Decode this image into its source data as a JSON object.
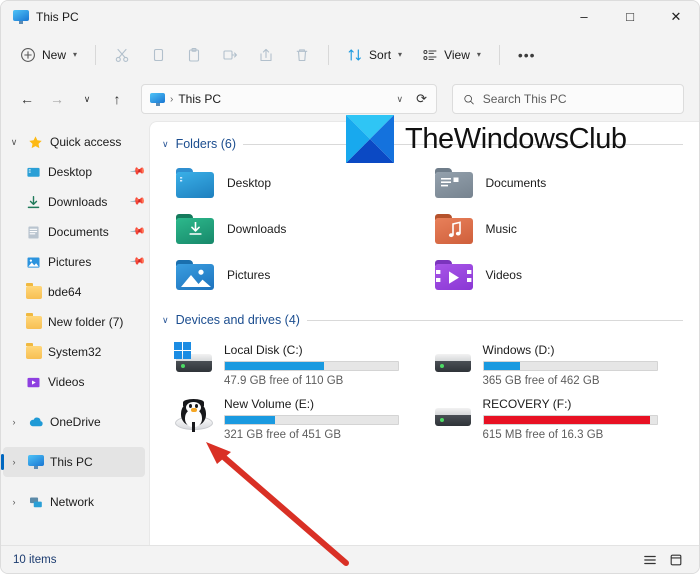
{
  "window": {
    "title": "This PC",
    "title_icon": "monitor-icon",
    "controls": {
      "minimize": "–",
      "maximize": "□",
      "close": "✕"
    }
  },
  "toolbar": {
    "new_label": "New",
    "sort_label": "Sort",
    "view_label": "View",
    "more_label": "•••",
    "icons": [
      "plus-icon",
      "cut-icon",
      "copy-icon",
      "paste-icon",
      "rename-icon",
      "share-icon",
      "delete-icon",
      "sort-icon",
      "view-icon",
      "more-icon"
    ]
  },
  "nav": {
    "back": "←",
    "forward": "→",
    "recent": "∨",
    "up": "↑",
    "refresh": "⟳",
    "address_text": "This PC",
    "address_icon": "monitor-icon",
    "crumb_sep": "›",
    "address_chevron": "∨"
  },
  "search": {
    "placeholder": "Search This PC",
    "value": "",
    "icon": "search-icon"
  },
  "sidebar": {
    "groups": [
      {
        "label": "Quick access",
        "icon": "star-icon",
        "expander": "∨",
        "expanded": true,
        "selected": false,
        "children": [
          {
            "label": "Desktop",
            "icon": "desktop-icon",
            "pinned": true
          },
          {
            "label": "Downloads",
            "icon": "downloads-icon",
            "pinned": true
          },
          {
            "label": "Documents",
            "icon": "documents-icon",
            "pinned": true
          },
          {
            "label": "Pictures",
            "icon": "pictures-icon",
            "pinned": true
          },
          {
            "label": "bde64",
            "icon": "folder-icon",
            "pinned": false
          },
          {
            "label": "New folder (7)",
            "icon": "folder-icon",
            "pinned": false
          },
          {
            "label": "System32",
            "icon": "folder-icon",
            "pinned": false
          },
          {
            "label": "Videos",
            "icon": "videos-icon",
            "pinned": false
          }
        ]
      },
      {
        "label": "OneDrive",
        "icon": "cloud-icon",
        "expander": "›",
        "expanded": false,
        "selected": false,
        "children": []
      },
      {
        "label": "This PC",
        "icon": "monitor-icon",
        "expander": "›",
        "expanded": false,
        "selected": true,
        "children": []
      },
      {
        "label": "Network",
        "icon": "network-icon",
        "expander": "›",
        "expanded": false,
        "selected": false,
        "children": []
      }
    ]
  },
  "content": {
    "folders_section": {
      "title": "Folders (6)",
      "chevron": "∨",
      "items": [
        {
          "name": "Desktop",
          "icon": "folder-desktop-icon",
          "color_back": "#2f8fd0",
          "color_front": "#2aa3e0"
        },
        {
          "name": "Documents",
          "icon": "folder-documents-icon",
          "color_back": "#7d8a96",
          "color_front": "#8e9aa6"
        },
        {
          "name": "Downloads",
          "icon": "folder-downloads-icon",
          "color_back": "#1f8f6e",
          "color_front": "#24a97f"
        },
        {
          "name": "Music",
          "icon": "folder-music-icon",
          "color_back": "#c25f35",
          "color_front": "#e07a52"
        },
        {
          "name": "Pictures",
          "icon": "folder-pictures-icon",
          "color_back": "#1f7ec4",
          "color_front": "#2b93de"
        },
        {
          "name": "Videos",
          "icon": "folder-videos-icon",
          "color_back": "#8a3fd1",
          "color_front": "#a24ae8"
        }
      ]
    },
    "drives_section": {
      "title": "Devices and drives (4)",
      "chevron": "∨",
      "items": [
        {
          "name": "Local Disk (C:)",
          "free": "47.9 GB free of 110 GB",
          "used_percent": 57,
          "bar_color": "#1a9ae0",
          "icon": "drive-windows-icon"
        },
        {
          "name": "Windows (D:)",
          "free": "365 GB free of 462 GB",
          "used_percent": 21,
          "bar_color": "#1a9ae0",
          "icon": "drive-icon"
        },
        {
          "name": "New Volume (E:)",
          "free": "321 GB free of 451 GB",
          "used_percent": 29,
          "bar_color": "#1a9ae0",
          "icon": "drive-linux-icon"
        },
        {
          "name": "RECOVERY (F:)",
          "free": "615 MB free of 16.3 GB",
          "used_percent": 96,
          "bar_color": "#e81123",
          "icon": "drive-icon"
        }
      ]
    }
  },
  "watermark": {
    "text": "TheWindowsClub",
    "logo": "thewindowsclub-logo"
  },
  "annotation": {
    "type": "red-arrow",
    "color": "#d93025",
    "points_to": "New Volume (E:) drive icon"
  },
  "statusbar": {
    "item_count": "10 items",
    "view_list_icon": "list-view-icon",
    "view_details_icon": "details-view-icon"
  }
}
